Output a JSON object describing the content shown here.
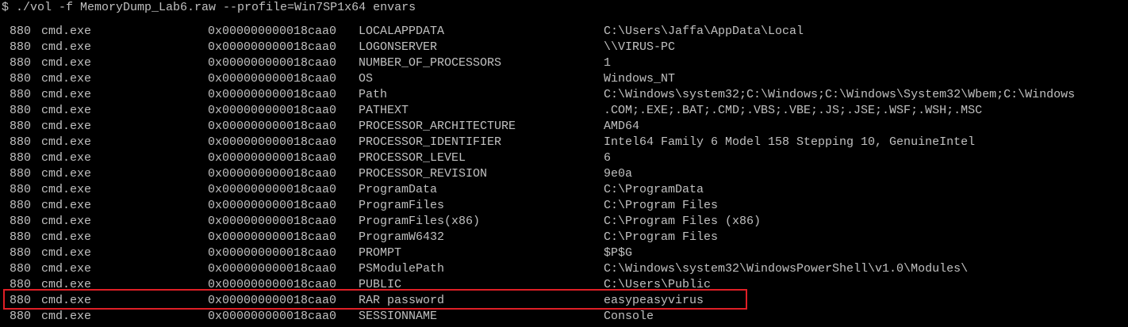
{
  "terminal": {
    "command": "$ ./vol -f MemoryDump_Lab6.raw --profile=Win7SP1x64 envars",
    "highlight_color": "#e01f26",
    "rows": [
      {
        "pid": "880",
        "process": "cmd.exe",
        "block": "0x000000000018caa0",
        "variable": "LOCALAPPDATA",
        "value": "C:\\Users\\Jaffa\\AppData\\Local"
      },
      {
        "pid": "880",
        "process": "cmd.exe",
        "block": "0x000000000018caa0",
        "variable": "LOGONSERVER",
        "value": "\\\\VIRUS-PC"
      },
      {
        "pid": "880",
        "process": "cmd.exe",
        "block": "0x000000000018caa0",
        "variable": "NUMBER_OF_PROCESSORS",
        "value": "1"
      },
      {
        "pid": "880",
        "process": "cmd.exe",
        "block": "0x000000000018caa0",
        "variable": "OS",
        "value": "Windows_NT"
      },
      {
        "pid": "880",
        "process": "cmd.exe",
        "block": "0x000000000018caa0",
        "variable": "Path",
        "value": "C:\\Windows\\system32;C:\\Windows;C:\\Windows\\System32\\Wbem;C:\\Windows"
      },
      {
        "pid": "880",
        "process": "cmd.exe",
        "block": "0x000000000018caa0",
        "variable": "PATHEXT",
        "value": ".COM;.EXE;.BAT;.CMD;.VBS;.VBE;.JS;.JSE;.WSF;.WSH;.MSC"
      },
      {
        "pid": "880",
        "process": "cmd.exe",
        "block": "0x000000000018caa0",
        "variable": "PROCESSOR_ARCHITECTURE",
        "value": "AMD64"
      },
      {
        "pid": "880",
        "process": "cmd.exe",
        "block": "0x000000000018caa0",
        "variable": "PROCESSOR_IDENTIFIER",
        "value": "Intel64 Family 6 Model 158 Stepping 10, GenuineIntel"
      },
      {
        "pid": "880",
        "process": "cmd.exe",
        "block": "0x000000000018caa0",
        "variable": "PROCESSOR_LEVEL",
        "value": "6"
      },
      {
        "pid": "880",
        "process": "cmd.exe",
        "block": "0x000000000018caa0",
        "variable": "PROCESSOR_REVISION",
        "value": "9e0a"
      },
      {
        "pid": "880",
        "process": "cmd.exe",
        "block": "0x000000000018caa0",
        "variable": "ProgramData",
        "value": "C:\\ProgramData"
      },
      {
        "pid": "880",
        "process": "cmd.exe",
        "block": "0x000000000018caa0",
        "variable": "ProgramFiles",
        "value": "C:\\Program Files"
      },
      {
        "pid": "880",
        "process": "cmd.exe",
        "block": "0x000000000018caa0",
        "variable": "ProgramFiles(x86)",
        "value": "C:\\Program Files (x86)"
      },
      {
        "pid": "880",
        "process": "cmd.exe",
        "block": "0x000000000018caa0",
        "variable": "ProgramW6432",
        "value": "C:\\Program Files"
      },
      {
        "pid": "880",
        "process": "cmd.exe",
        "block": "0x000000000018caa0",
        "variable": "PROMPT",
        "value": "$P$G"
      },
      {
        "pid": "880",
        "process": "cmd.exe",
        "block": "0x000000000018caa0",
        "variable": "PSModulePath",
        "value": "C:\\Windows\\system32\\WindowsPowerShell\\v1.0\\Modules\\"
      },
      {
        "pid": "880",
        "process": "cmd.exe",
        "block": "0x000000000018caa0",
        "variable": "PUBLIC",
        "value": "C:\\Users\\Public"
      },
      {
        "pid": "880",
        "process": "cmd.exe",
        "block": "0x000000000018caa0",
        "variable": "RAR password",
        "value": "easypeasyvirus"
      },
      {
        "pid": "880",
        "process": "cmd.exe",
        "block": "0x000000000018caa0",
        "variable": "SESSIONNAME",
        "value": "Console"
      }
    ]
  }
}
